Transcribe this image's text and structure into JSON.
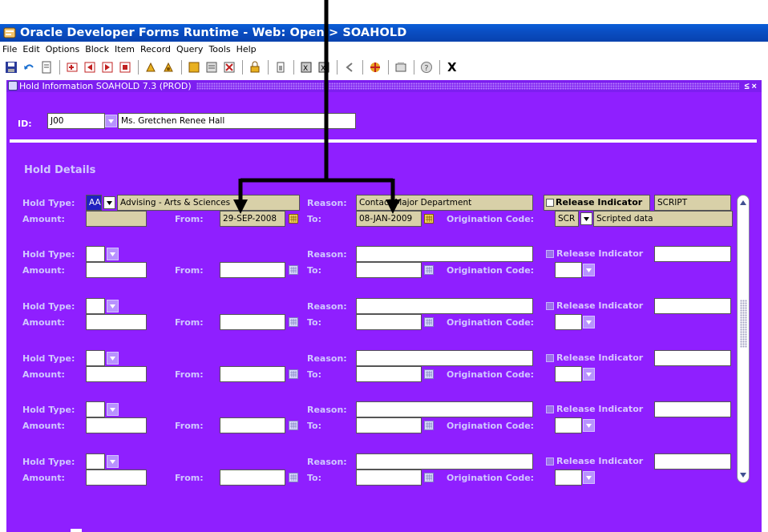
{
  "window": {
    "title": "Oracle Developer Forms Runtime - Web:  Open > SOAHOLD"
  },
  "menu": [
    {
      "label": "File"
    },
    {
      "label": "Edit"
    },
    {
      "label": "Options"
    },
    {
      "label": "Block"
    },
    {
      "label": "Item"
    },
    {
      "label": "Record"
    },
    {
      "label": "Query"
    },
    {
      "label": "Tools"
    },
    {
      "label": "Help"
    }
  ],
  "toolbar": {
    "exit_label": "X",
    "icons": [
      "save-icon",
      "rollback-icon",
      "print-icon",
      "insert-record-icon",
      "previous-block-icon",
      "next-block-icon",
      "previous-record-icon",
      "enter-query-icon",
      "execute-query-icon",
      "cancel-query-icon",
      "remove-record-icon",
      "insert-icon",
      "lock-record-icon",
      "delete-record-icon",
      "duplicate-icon",
      "list-icon",
      "back-icon",
      "help-icon"
    ]
  },
  "form": {
    "title": "Hold Information  SOAHOLD  7.3  (PROD)",
    "window_controls": "≤ ×",
    "id_label": "ID:",
    "id_value": "J00",
    "name_value": "Ms. Gretchen Renee Hall",
    "section_title": "Hold Details"
  },
  "labels": {
    "hold_type": "Hold Type:",
    "amount": "Amount:",
    "from": "From:",
    "to": "To:",
    "reason": "Reason:",
    "release_indicator": "Release Indicator",
    "origination_code": "Origination Code:"
  },
  "records": [
    {
      "hold_type_code": "AA",
      "hold_type_desc": "Advising - Arts & Sciences",
      "reason": "Contact Major Department",
      "release_user": "SCRIPT",
      "amount": "",
      "from_date": "29-SEP-2008",
      "to_date": "08-JAN-2009",
      "origination_code": "SCR",
      "origination_desc": "Scripted data"
    },
    {
      "hold_type_code": "",
      "reason": "",
      "release_user": "",
      "amount": "",
      "from_date": "",
      "to_date": "",
      "origination_code": ""
    },
    {
      "hold_type_code": "",
      "reason": "",
      "release_user": "",
      "amount": "",
      "from_date": "",
      "to_date": "",
      "origination_code": ""
    },
    {
      "hold_type_code": "",
      "reason": "",
      "release_user": "",
      "amount": "",
      "from_date": "",
      "to_date": "",
      "origination_code": ""
    },
    {
      "hold_type_code": "",
      "reason": "",
      "release_user": "",
      "amount": "",
      "from_date": "",
      "to_date": "",
      "origination_code": ""
    },
    {
      "hold_type_code": "",
      "reason": "",
      "release_user": "",
      "amount": "",
      "from_date": "",
      "to_date": "",
      "origination_code": ""
    }
  ],
  "colors": {
    "form_background": "#8f1fff",
    "title_bar": "#0a4fc4",
    "active_field": "#d8d0a8"
  }
}
